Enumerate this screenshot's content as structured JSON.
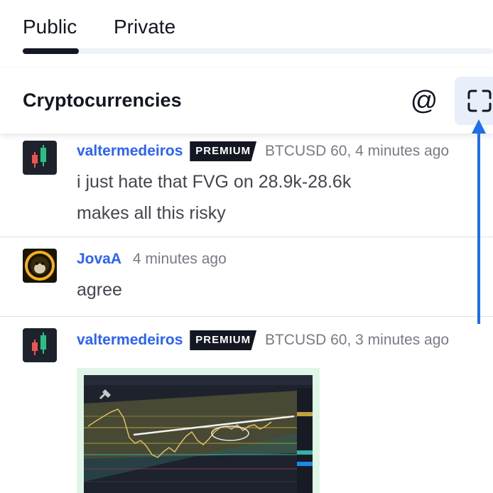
{
  "tabs": [
    {
      "label": "Public"
    },
    {
      "label": "Private"
    }
  ],
  "room": {
    "title": "Cryptocurrencies",
    "mention_symbol": "@"
  },
  "messages": [
    {
      "username": "valtermedeiros",
      "badge": "PREMIUM",
      "symbol": "BTCUSD 60,",
      "time": "4 minutes ago",
      "lines": [
        "i just hate that FVG on 28.9k-28.6k",
        "makes all this risky"
      ]
    },
    {
      "username": "JovaA",
      "time": "4 minutes ago",
      "lines": [
        "agree"
      ]
    },
    {
      "username": "valtermedeiros",
      "badge": "PREMIUM",
      "symbol": "BTCUSD 60,",
      "time": "3 minutes ago",
      "attachment": "chart-snapshot"
    }
  ],
  "colors": {
    "accent": "#2962ff",
    "badge_bg": "#131722",
    "annotation_arrow": "#1f6feb"
  }
}
